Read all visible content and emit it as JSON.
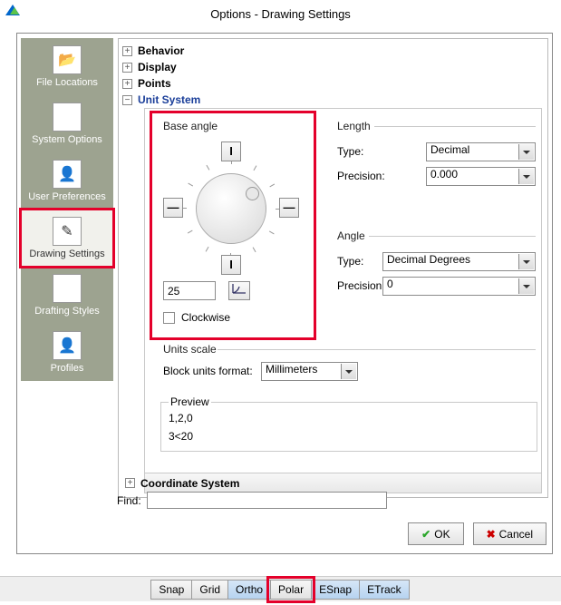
{
  "title": "Options - Drawing Settings",
  "sidebar": {
    "items": [
      {
        "label": "File Locations"
      },
      {
        "label": "System Options"
      },
      {
        "label": "User Preferences"
      },
      {
        "label": "Drawing Settings"
      },
      {
        "label": "Drafting Styles"
      },
      {
        "label": "Profiles"
      }
    ]
  },
  "tree": {
    "behavior": "Behavior",
    "display": "Display",
    "points": "Points",
    "unit_system": "Unit System",
    "coordinate_system": "Coordinate System"
  },
  "base_angle": {
    "title": "Base angle",
    "up": "I",
    "down": "I",
    "left": "—",
    "right": "—",
    "value": "25",
    "clockwise_label": "Clockwise"
  },
  "length": {
    "title": "Length",
    "type_label": "Type:",
    "type_value": "Decimal",
    "precision_label": "Precision:",
    "precision_value": "0.000"
  },
  "angle": {
    "title": "Angle",
    "type_label": "Type:",
    "type_value": "Decimal Degrees",
    "precision_label": "Precision:",
    "precision_value": "0"
  },
  "units_scale": {
    "title": "Units scale",
    "block_label": "Block units format:",
    "block_value": "Millimeters"
  },
  "preview": {
    "title": "Preview",
    "line1": "1,2,0",
    "line2": "3<20"
  },
  "find_label": "Find:",
  "buttons": {
    "ok": "OK",
    "cancel": "Cancel"
  },
  "status": {
    "snap": "Snap",
    "grid": "Grid",
    "ortho": "Ortho",
    "polar": "Polar",
    "esnap": "ESnap",
    "etrack": "ETrack"
  }
}
